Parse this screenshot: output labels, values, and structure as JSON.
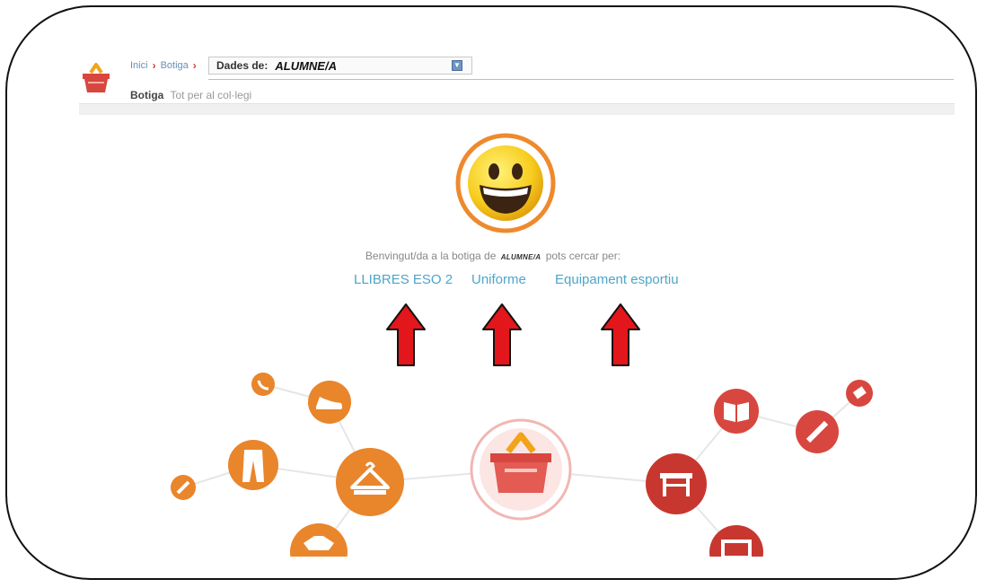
{
  "breadcrumb": {
    "items": [
      "Inici",
      "Botiga"
    ]
  },
  "selector": {
    "label": "Dades de:",
    "value": "ALUMNE/A"
  },
  "section": {
    "title": "Botiga",
    "subtitle": "Tot per al col·legi"
  },
  "welcome": {
    "prefix": "Benvingut/da a la botiga de",
    "name": "ALUMNE/A",
    "suffix": "pots cercar per:"
  },
  "categories": [
    {
      "label": "LLIBRES ESO 2"
    },
    {
      "label": "Uniforme"
    },
    {
      "label": "Equipament esportiu"
    }
  ],
  "colors": {
    "link": "#4ea5c8",
    "accent_orange": "#e9852b",
    "accent_red": "#d8473f",
    "arrow_red": "#e3161b"
  },
  "icons": {
    "logo": "basket-icon",
    "smiley": "smiley-icon",
    "arrow": "up-arrow-icon",
    "select_arrow": "chevron-down-icon"
  }
}
